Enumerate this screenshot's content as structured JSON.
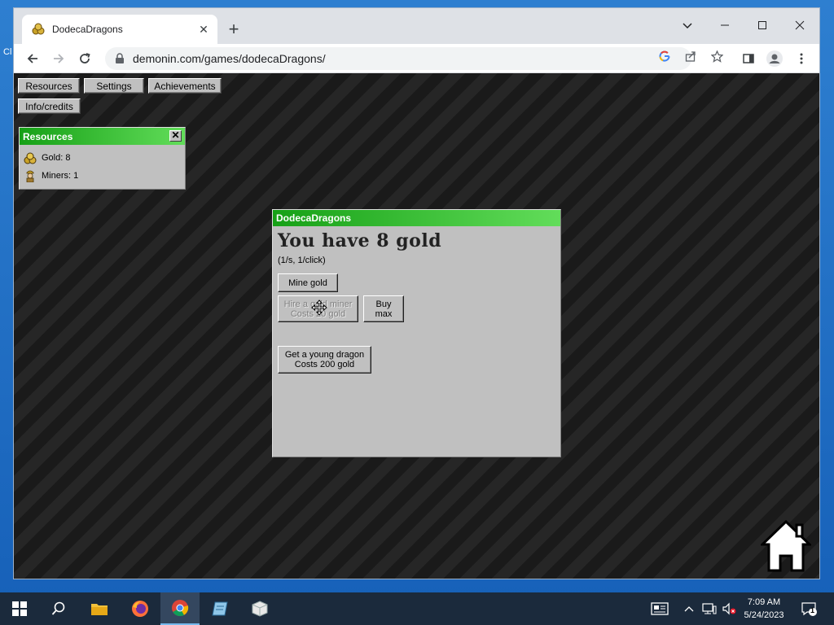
{
  "browser": {
    "tab_title": "DodecaDragons",
    "url": "demonin.com/games/dodecaDragons/",
    "new_tab_label": "+",
    "tab_close": "✕"
  },
  "desktop": {
    "edge_label": "Cl"
  },
  "page": {
    "menu": {
      "resources": "Resources",
      "settings": "Settings",
      "achievements": "Achievements",
      "info": "Info/credits"
    },
    "resources_panel": {
      "title": "Resources",
      "close": "✕",
      "items": [
        {
          "label": "Gold: 8",
          "icon": "gold-icon"
        },
        {
          "label": "Miners: 1",
          "icon": "miner-icon"
        }
      ]
    },
    "main_panel": {
      "title": "DodecaDragons",
      "heading": "You have 8 gold",
      "rate": "(1/s, 1/click)",
      "mine_button": "Mine gold",
      "hire_button_line1": "Hire a gold miner",
      "hire_button_line2": "Costs 20 gold",
      "buy_max_line1": "Buy",
      "buy_max_line2": "max",
      "dragon_button_line1": "Get a young dragon",
      "dragon_button_line2": "Costs 200 gold"
    }
  },
  "taskbar": {
    "time": "7:09 AM",
    "date": "5/24/2023",
    "notification_count": "1"
  },
  "colors": {
    "title_gradient_start": "#16a016",
    "title_gradient_end": "#62dd5a",
    "panel_gray": "#c0c0c0",
    "taskbar": "#1b2a3c"
  }
}
